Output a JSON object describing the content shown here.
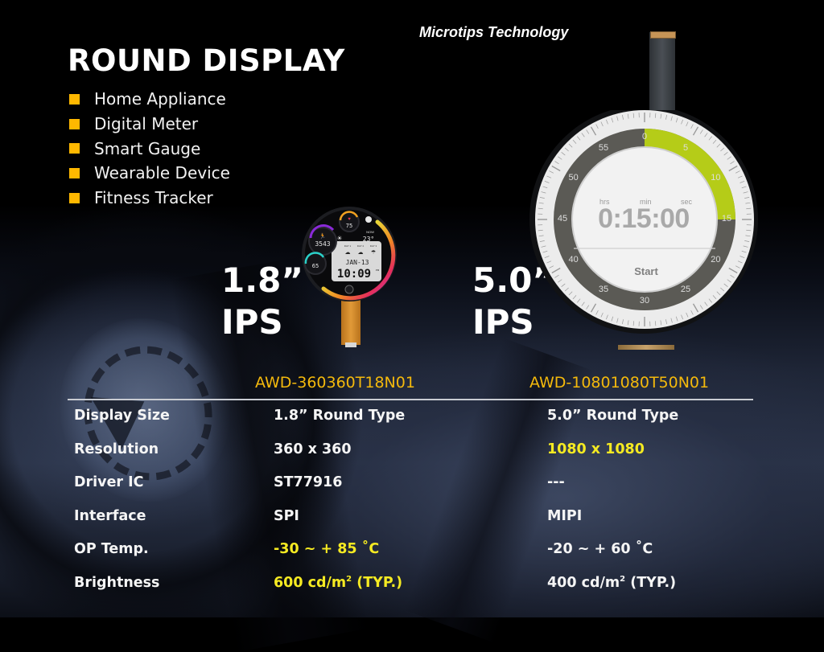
{
  "brand": "Microtips Technology",
  "title": "ROUND DISPLAY",
  "applications": [
    "Home Appliance",
    "Digital Meter",
    "Smart Gauge",
    "Wearable Device",
    "Fitness Tracker"
  ],
  "bullet_color": "#ffb800",
  "products": [
    {
      "size": "1.8”",
      "panel": "IPS",
      "model": "AWD-360360T18N01",
      "watch_face": {
        "heart_rate": "75",
        "steps": "3543",
        "battery": "65",
        "weather_label": "NOW",
        "temperature": "23°",
        "forecast_days": [
          "DAY 1",
          "DAY 2",
          "DAY 3"
        ],
        "date": "JAN-13",
        "time": "10:09",
        "ampm": "PM"
      }
    },
    {
      "size": "5.0”",
      "panel": "IPS",
      "model": "AWD-10801080T50N01",
      "timer_ui": {
        "units": [
          "hrs",
          "min",
          "sec"
        ],
        "time": "0:15:00",
        "button": "Start",
        "dial_numbers": [
          "0",
          "5",
          "10",
          "15",
          "20",
          "25",
          "30",
          "35",
          "40",
          "45",
          "50",
          "55"
        ],
        "progress_minutes": 15,
        "progress_color": "#b5cc18"
      }
    }
  ],
  "specs": {
    "rows": [
      {
        "label": "Display Size",
        "values": [
          "1.8” Round Type",
          "5.0” Round Type"
        ],
        "highlight": [
          false,
          false
        ]
      },
      {
        "label": "Resolution",
        "values": [
          "360 x 360",
          "1080 x 1080"
        ],
        "highlight": [
          false,
          true
        ]
      },
      {
        "label": "Driver IC",
        "values": [
          "ST77916",
          "---"
        ],
        "highlight": [
          false,
          false
        ]
      },
      {
        "label": "Interface",
        "values": [
          "SPI",
          "MIPI"
        ],
        "highlight": [
          false,
          false
        ]
      },
      {
        "label": "OP Temp.",
        "values": [
          "-30 ~ + 85 ˚C",
          "-20 ~ + 60 ˚C"
        ],
        "highlight": [
          true,
          false
        ]
      },
      {
        "label": "Brightness",
        "values": [
          "600 cd/m² (TYP.)",
          "400 cd/m² (TYP.)"
        ],
        "highlight": [
          true,
          false
        ]
      }
    ]
  },
  "colors": {
    "model_text": "#f4b90c",
    "highlight_text": "#f5ea22",
    "body_text": "#f5f5f5"
  }
}
